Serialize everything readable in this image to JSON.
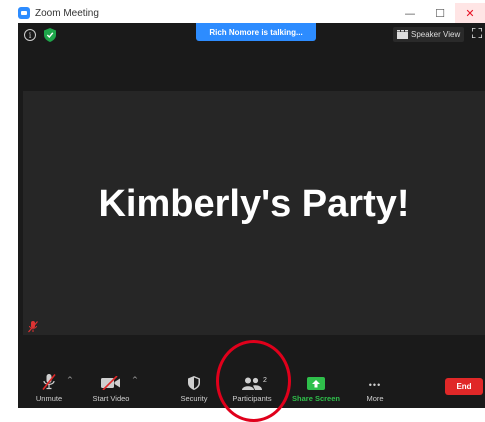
{
  "window": {
    "title": "Zoom Meeting",
    "min_glyph": "—",
    "max_glyph": "☐",
    "close_glyph": "✕"
  },
  "meeting": {
    "talking_banner": "Rich Nomore is talking...",
    "speaker_view_label": "Speaker View",
    "stage_text": "Kimberly's Party!",
    "info_glyph": "i"
  },
  "toolbar": {
    "unmute_label": "Unmute",
    "start_video_label": "Start Video",
    "security_label": "Security",
    "participants_label": "Participants",
    "participants_count": "2",
    "share_screen_label": "Share Screen",
    "more_label": "More",
    "more_glyph": "•••",
    "end_label": "End",
    "caret_glyph": "^"
  },
  "colors": {
    "accent_blue": "#2d8cff",
    "share_green": "#2fbf4b",
    "end_red": "#e02828",
    "highlight_red": "#e0001b",
    "meeting_bg": "#1a1a1a",
    "stage_bg": "#262626"
  }
}
